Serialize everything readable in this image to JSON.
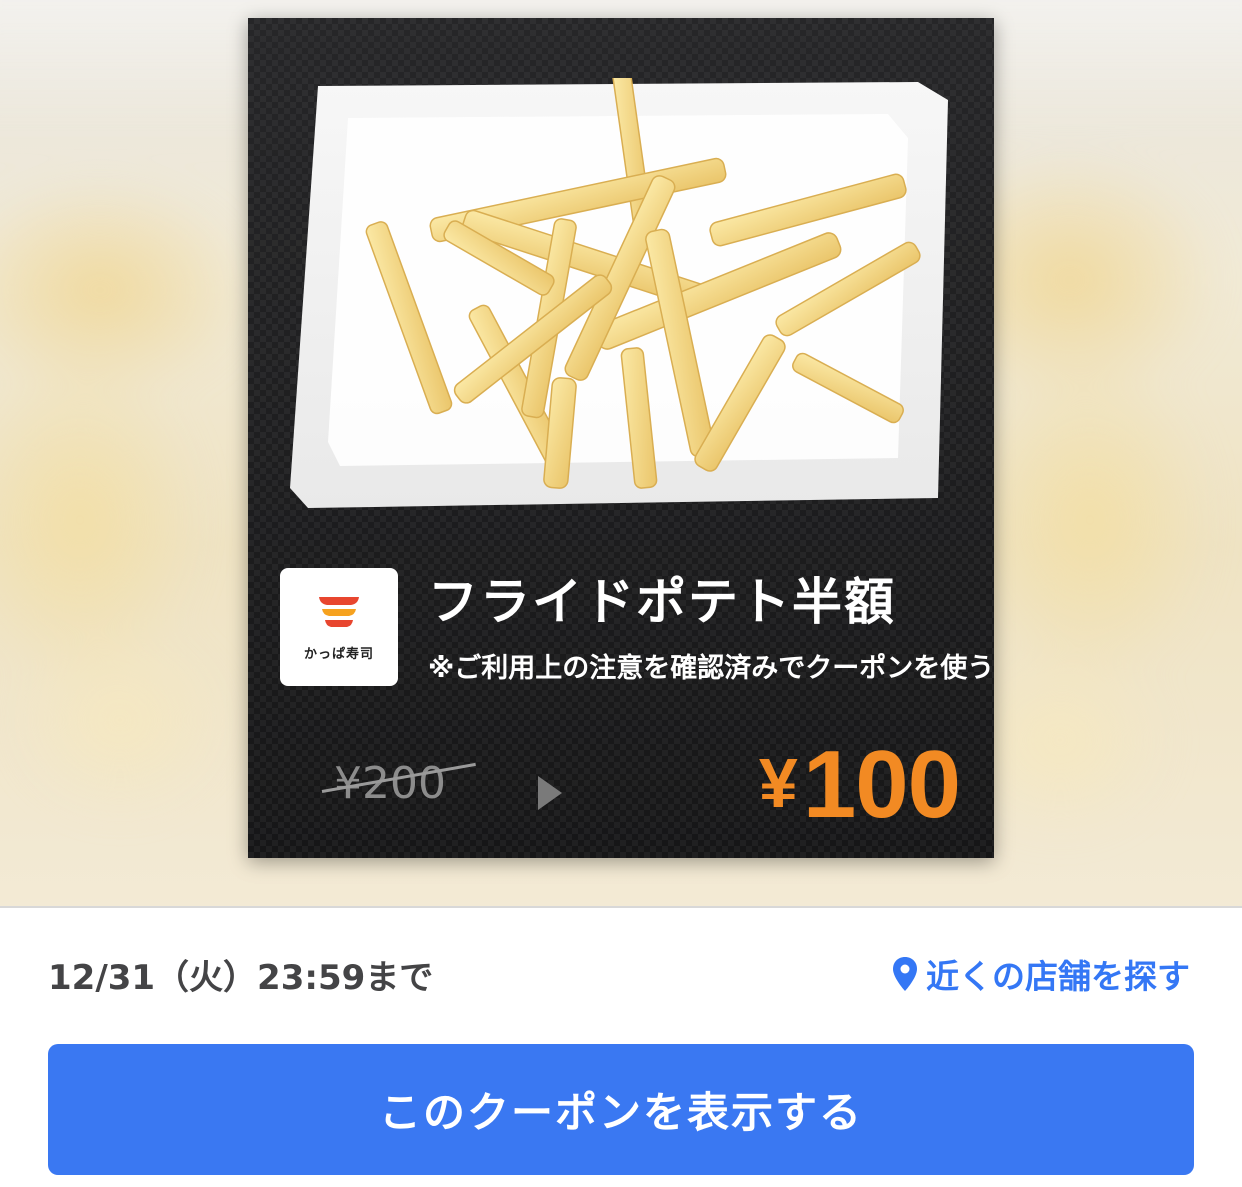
{
  "coupon": {
    "brand_name": "かっぱ寿司",
    "title": "フライドポテト半額",
    "note": "※ご利用上の注意を確認済みでクーポンを使う",
    "original_price": "¥200",
    "discount_price_symbol": "¥",
    "discount_price_value": "100",
    "image_icon": "french-fries-plate-photo",
    "colors": {
      "card_background": "#1d1d1f",
      "price_accent": "#f28a23"
    }
  },
  "footer": {
    "deadline": "12/31（火）23:59まで",
    "find_store_label": "近くの店舗を探す",
    "find_store_icon": "location-pin-icon",
    "cta_label": "このクーポンを表示する",
    "colors": {
      "link": "#3477f5",
      "cta_background": "#3a78f2"
    }
  }
}
